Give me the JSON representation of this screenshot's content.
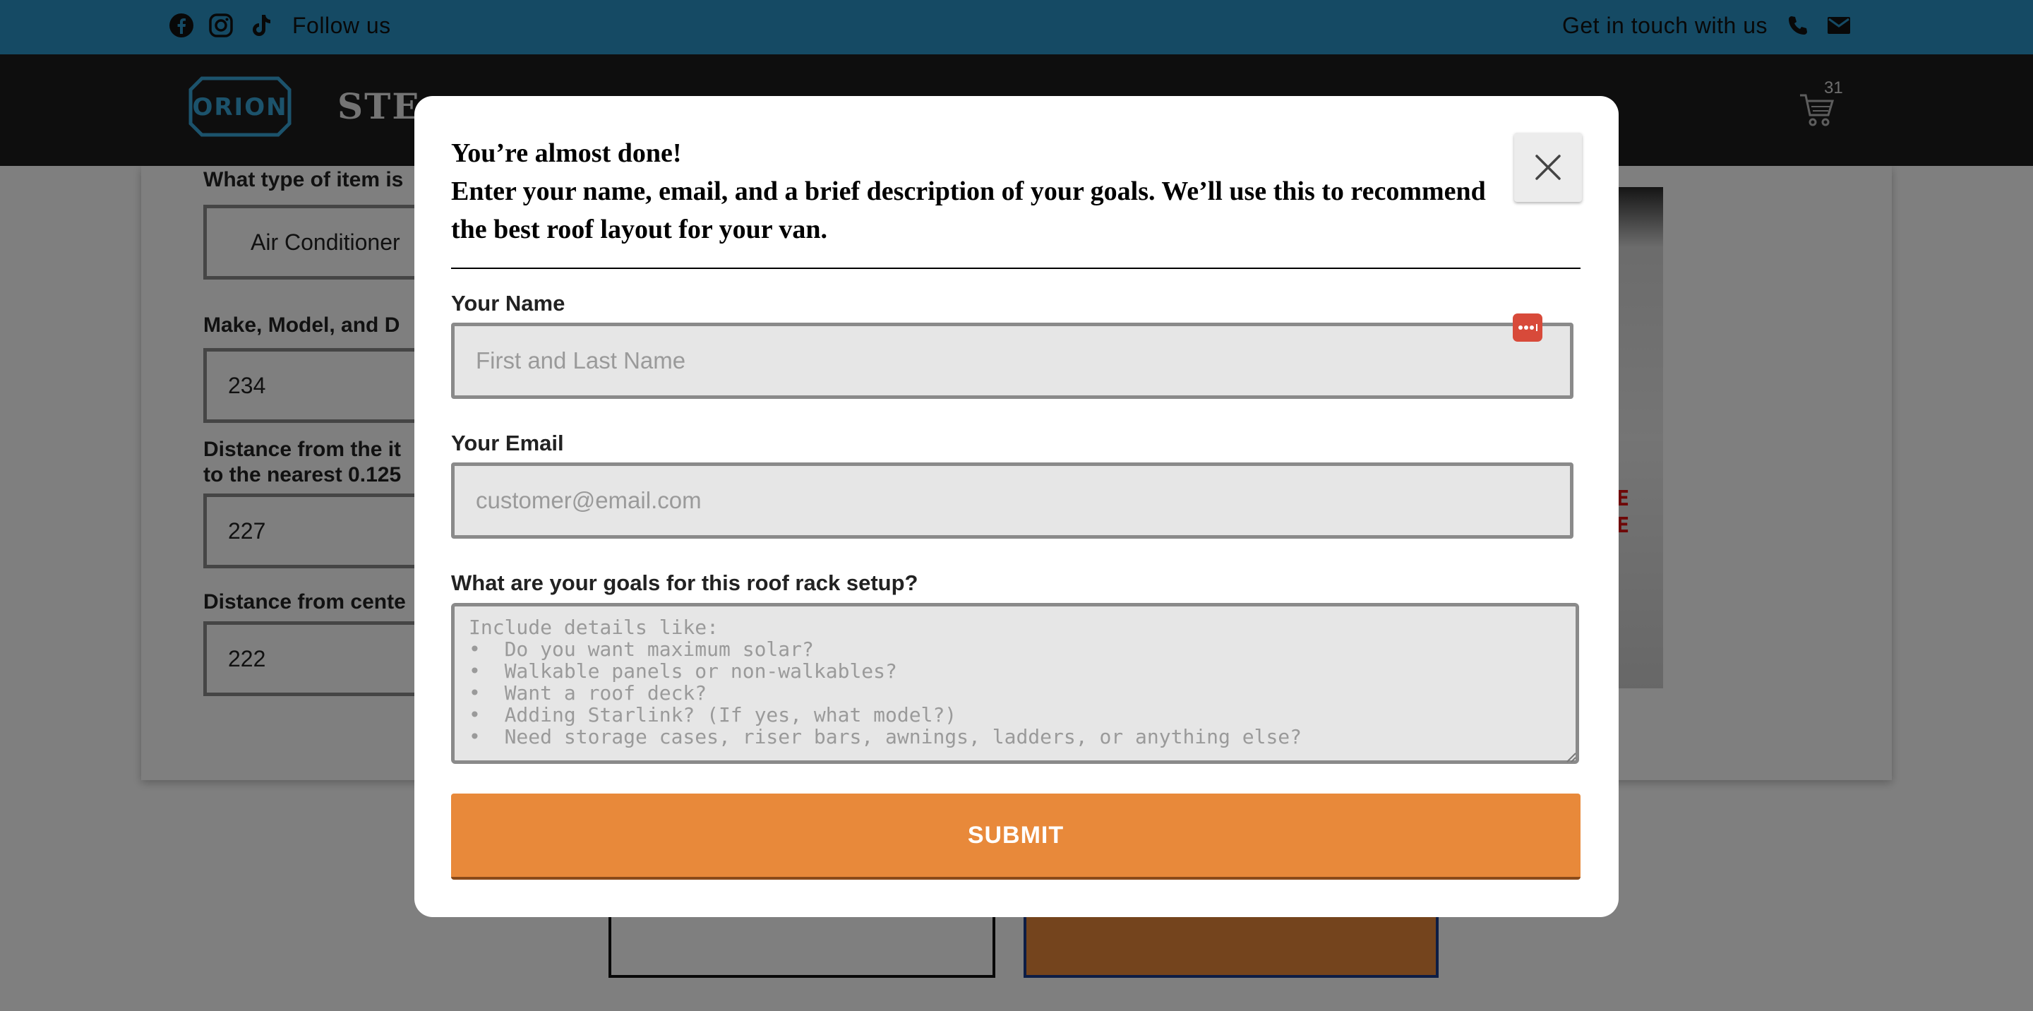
{
  "topbar": {
    "follow_text": "Follow us",
    "contact_text": "Get in touch with us",
    "bg_color": "#2a94c8",
    "social_icons": [
      "facebook-icon",
      "instagram-icon",
      "tiktok-icon"
    ],
    "contact_icons": [
      "phone-icon",
      "mail-icon"
    ]
  },
  "header": {
    "logo_text": "ORION",
    "title_partial": "STE",
    "cart_count": "31"
  },
  "background_form": {
    "q1_label": "What type of item is",
    "q1_value": "Air Conditioner",
    "q2_label": "Make, Model, and D",
    "q2_value": "234",
    "q3_label_line1": "Distance from the it",
    "q3_label_line2": "to the nearest 0.125",
    "q3_value": "227",
    "q4_label": "Distance from cente",
    "q4_value": "222",
    "van_text": [
      "LE",
      "GE"
    ]
  },
  "modal": {
    "title_line1": "You’re almost done!",
    "title_line2": "Enter your name, email, and a brief description of your goals. We’ll use this to recommend the best roof layout for your van.",
    "name_label": "Your Name",
    "name_placeholder": "First and Last Name",
    "email_label": "Your Email",
    "email_placeholder": "customer@email.com",
    "goals_label": "What are your goals for this roof rack setup?",
    "goals_placeholder": "Include details like:\n•  Do you want maximum solar?\n•  Walkable panels or non-walkables?\n•  Want a roof deck?\n•  Adding Starlink? (If yes, what model?)\n•  Need storage cases, riser bars, awnings, ladders, or anything else?",
    "submit_label": "SUBMIT",
    "submit_color": "#e8893a"
  }
}
